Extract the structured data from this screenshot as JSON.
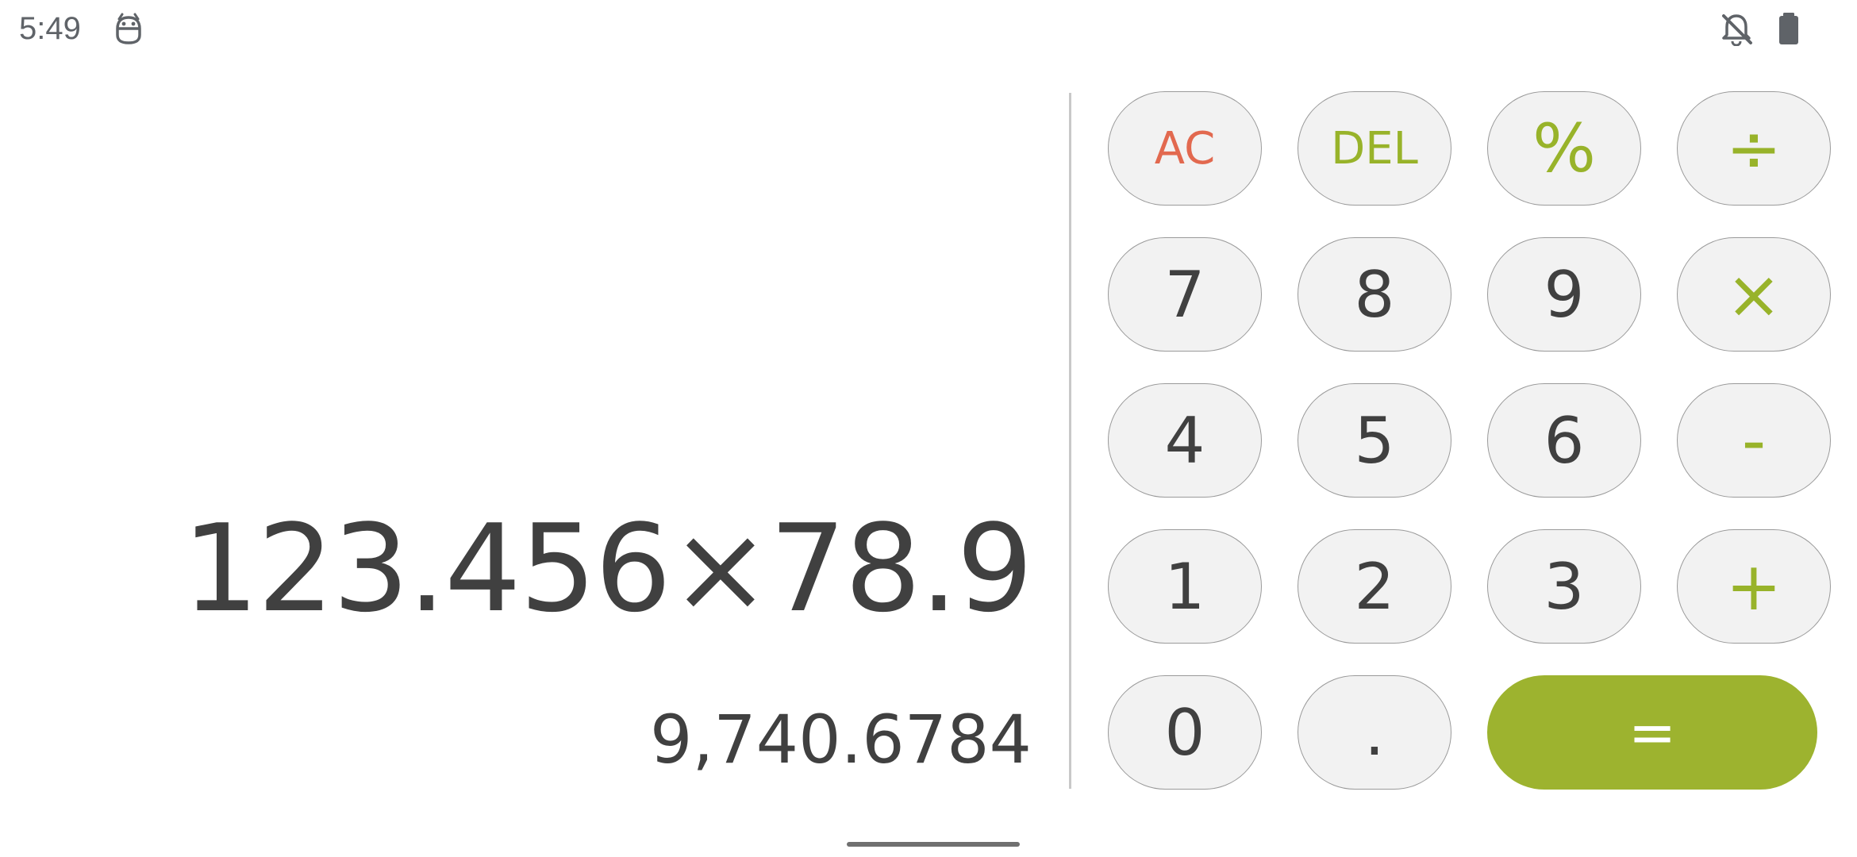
{
  "status_bar": {
    "time": "5:49",
    "icons": [
      "app-notification-icon",
      "bell-off-icon",
      "battery-icon"
    ]
  },
  "display": {
    "expression": "123.456×78.9",
    "result": "9,740.6784"
  },
  "keypad": {
    "row1": [
      "AC",
      "DEL",
      "%",
      "÷"
    ],
    "row2": [
      "7",
      "8",
      "9",
      "×"
    ],
    "row3": [
      "4",
      "5",
      "6",
      "-"
    ],
    "row4": [
      "1",
      "2",
      "3",
      "+"
    ],
    "row5": [
      "0",
      ".",
      "="
    ]
  },
  "colors": {
    "accent": "#98b32a",
    "equals_bg": "#9db32f",
    "clear": "#e2694f",
    "digits": "#404040",
    "key_bg": "#f2f2f2"
  }
}
